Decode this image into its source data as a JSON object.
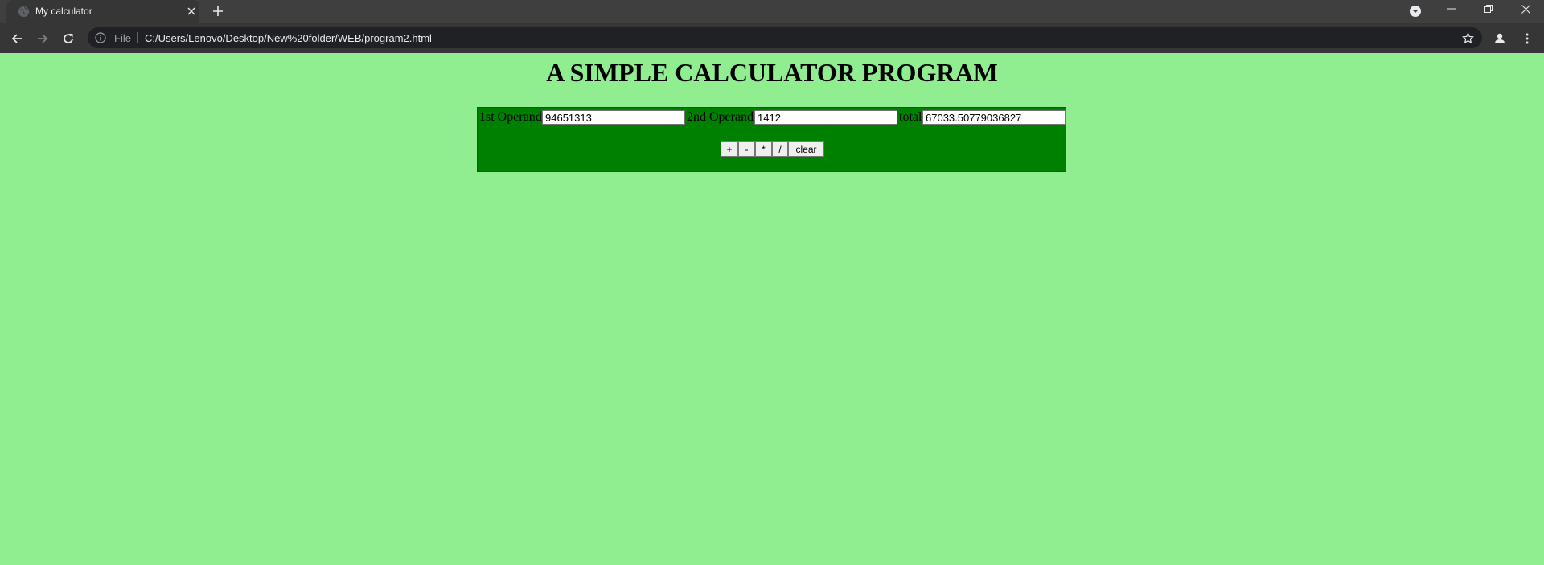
{
  "browser": {
    "tab": {
      "title": "My calculator",
      "favicon": "globe-icon"
    },
    "omnibox": {
      "scheme_label": "File",
      "url": "C:/Users/Lenovo/Desktop/New%20folder/WEB/program2.html"
    },
    "icons": {
      "back": "arrow-left-icon",
      "forward": "arrow-right-icon",
      "reload": "reload-icon",
      "info": "info-icon",
      "bookmark": "star-icon",
      "profile": "person-icon",
      "menu": "kebab-menu-icon",
      "new_tab": "plus-icon",
      "tab_close": "close-icon",
      "tab_search": "chevron-down-icon"
    },
    "colors": {
      "tabstrip": "#3f3f3f",
      "toolbar": "#363636",
      "omnibox": "#202124"
    }
  },
  "page": {
    "title": "A SIMPLE CALCULATOR PROGRAM",
    "background": "#90ee90",
    "calculator": {
      "panel_color": "#008000",
      "operand1": {
        "label": "1st Operand",
        "value": "94651313"
      },
      "operand2": {
        "label": "2nd Operand",
        "value": "1412"
      },
      "total": {
        "label": "total",
        "value": "67033.50779036827"
      },
      "buttons": {
        "add": "+",
        "subtract": "-",
        "multiply": "*",
        "divide": "/",
        "clear": "clear"
      }
    }
  }
}
